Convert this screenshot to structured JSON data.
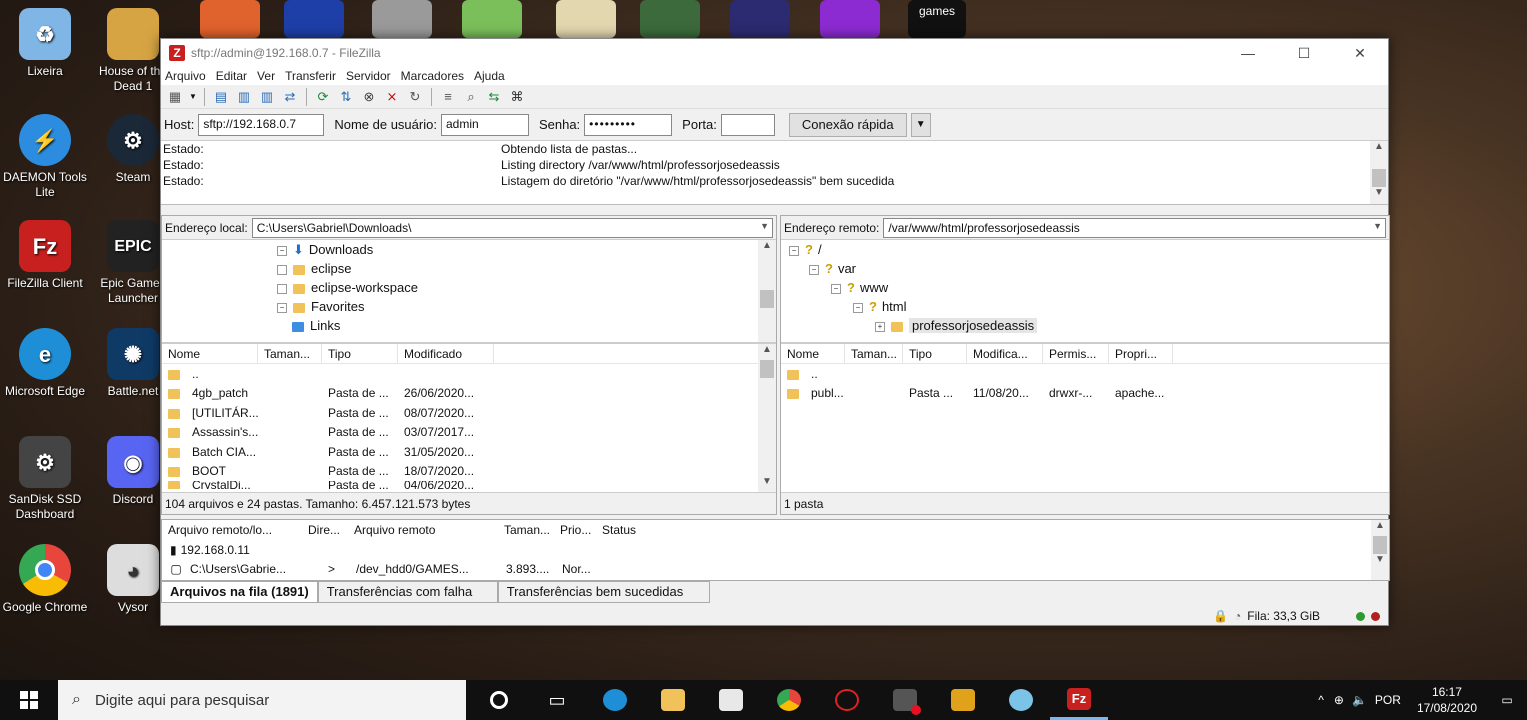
{
  "desktop": {
    "icons": [
      {
        "label": "Lixeira",
        "color": "#7fb6e6"
      },
      {
        "label": "House of the Dead 1",
        "color": "#d6a443"
      },
      {
        "label": "DAEMON Tools Lite",
        "color": "#2c8de0"
      },
      {
        "label": "Steam",
        "color": "#1b2838"
      },
      {
        "label": "FileZilla Client",
        "color": "#c8201f"
      },
      {
        "label": "Epic Games Launcher",
        "color": "#222222"
      },
      {
        "label": "Microsoft Edge",
        "color": "#1e8fd6"
      },
      {
        "label": "Battle.net",
        "color": "#0f3a66"
      },
      {
        "label": "SanDisk SSD Dashboard",
        "color": "#444444"
      },
      {
        "label": "Discord",
        "color": "#5865f2"
      },
      {
        "label": "Google Chrome",
        "color": "#e8453c"
      },
      {
        "label": "Vysor",
        "color": "#dddddd"
      }
    ],
    "top_label": "games"
  },
  "window": {
    "title": "sftp://admin@192.168.0.7 - FileZilla",
    "menu": [
      "Arquivo",
      "Editar",
      "Ver",
      "Transferir",
      "Servidor",
      "Marcadores",
      "Ajuda"
    ]
  },
  "quickconnect": {
    "host_label": "Host:",
    "host_value": "sftp://192.168.0.7",
    "user_label": "Nome de usuário:",
    "user_value": "admin",
    "pass_label": "Senha:",
    "pass_value": "•••••••••",
    "port_label": "Porta:",
    "port_value": "",
    "connect_label": "Conexão rápida"
  },
  "log": [
    {
      "label": "Estado:",
      "text": "Obtendo lista de pastas..."
    },
    {
      "label": "Estado:",
      "text": "Listing directory /var/www/html/professorjosedeassis"
    },
    {
      "label": "Estado:",
      "text": "Listagem do diretório \"/var/www/html/professorjosedeassis\" bem sucedida"
    }
  ],
  "local": {
    "addr_label": "Endereço local:",
    "addr_value": "C:\\Users\\Gabriel\\Downloads\\",
    "tree": [
      "Downloads",
      "eclipse",
      "eclipse-workspace",
      "Favorites",
      "Links"
    ],
    "columns": [
      "Nome",
      "Taman...",
      "Tipo",
      "Modificado"
    ],
    "rows": [
      {
        "name": "..",
        "size": "",
        "type": "",
        "modified": ""
      },
      {
        "name": "4gb_patch",
        "size": "",
        "type": "Pasta de ...",
        "modified": "26/06/2020..."
      },
      {
        "name": "[UTILITÁR...",
        "size": "",
        "type": "Pasta de ...",
        "modified": "08/07/2020..."
      },
      {
        "name": "Assassin's...",
        "size": "",
        "type": "Pasta de ...",
        "modified": "03/07/2017..."
      },
      {
        "name": "Batch CIA...",
        "size": "",
        "type": "Pasta de ...",
        "modified": "31/05/2020..."
      },
      {
        "name": "BOOT",
        "size": "",
        "type": "Pasta de ...",
        "modified": "18/07/2020..."
      },
      {
        "name": "CrystalDi...",
        "size": "",
        "type": "Pasta de ...",
        "modified": "04/06/2020..."
      }
    ],
    "status": "104 arquivos e 24 pastas. Tamanho: 6.457.121.573 bytes"
  },
  "remote": {
    "addr_label": "Endereço remoto:",
    "addr_value": "/var/www/html/professorjosedeassis",
    "tree": [
      "/",
      "var",
      "www",
      "html",
      "professorjosedeassis"
    ],
    "columns": [
      "Nome",
      "Taman...",
      "Tipo",
      "Modifica...",
      "Permis...",
      "Propri..."
    ],
    "rows": [
      {
        "name": "..",
        "size": "",
        "type": "",
        "modified": "",
        "perms": "",
        "owner": ""
      },
      {
        "name": "publ...",
        "size": "",
        "type": "Pasta ...",
        "modified": "11/08/20...",
        "perms": "drwxr-...",
        "owner": "apache..."
      }
    ],
    "status": "1 pasta"
  },
  "queue": {
    "columns": [
      "Arquivo remoto/lo...",
      "Dire...",
      "Arquivo remoto",
      "Taman...",
      "Prio...",
      "Status"
    ],
    "server": "192.168.0.11",
    "row": {
      "local": "C:\\Users\\Gabrie...",
      "dir": ">",
      "remote": "/dev_hdd0/GAMES...",
      "size": "3.893....",
      "prio": "Nor..."
    },
    "tabs": [
      "Arquivos na fila (1891)",
      "Transferências com falha",
      "Transferências bem sucedidas"
    ],
    "footer": "Fila: 33,3 GiB"
  },
  "taskbar": {
    "search_placeholder": "Digite aqui para pesquisar",
    "lang": "POR",
    "time": "16:17",
    "date": "17/08/2020"
  }
}
